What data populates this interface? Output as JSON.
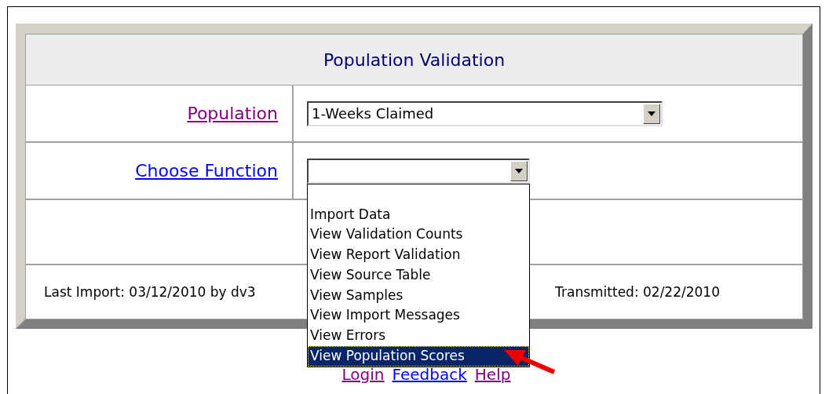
{
  "form": {
    "title": "Population Validation",
    "fields": [
      {
        "label": "Population",
        "visited": true,
        "value": "1-Weeks Claimed",
        "wide": true
      },
      {
        "label": "Choose Function",
        "visited": false,
        "expanded": true,
        "wide": false,
        "options": [
          {
            "label": "Import Data",
            "selected": false
          },
          {
            "label": "View Validation Counts",
            "selected": false
          },
          {
            "label": "View Report Validation",
            "selected": false
          },
          {
            "label": "View Source Table",
            "selected": false
          },
          {
            "label": "View Samples",
            "selected": false
          },
          {
            "label": "View Import Messages",
            "selected": false
          },
          {
            "label": "View Errors",
            "selected": false
          },
          {
            "label": "View Population Scores",
            "selected": true
          }
        ]
      }
    ],
    "footer": {
      "left": "Last Import: 03/12/2010 by dv3",
      "right": "Transmitted: 02/22/2010"
    }
  },
  "links": [
    {
      "label": "Login",
      "visited": true
    },
    {
      "label": "Feedback",
      "visited": false
    },
    {
      "label": "Help",
      "visited": true
    }
  ]
}
